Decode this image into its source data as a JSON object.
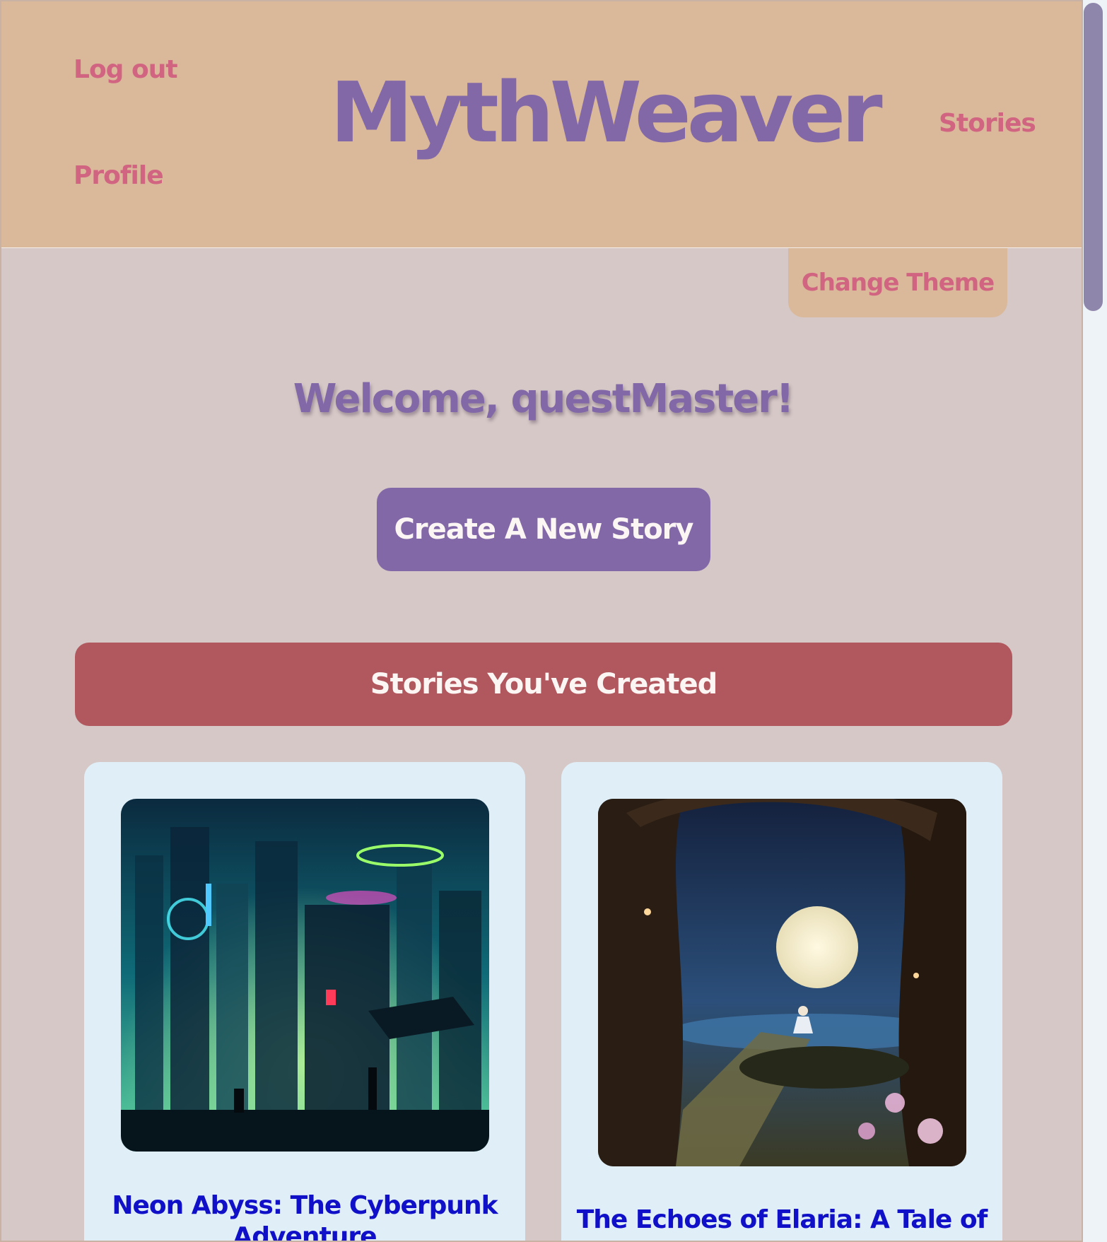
{
  "header": {
    "brand": "MythWeaver",
    "nav": {
      "logout": "Log out",
      "profile": "Profile",
      "stories": "Stories"
    }
  },
  "theme_button": "Change Theme",
  "welcome": "Welcome, questMaster!",
  "create_button": "Create A New Story",
  "section_title": "Stories You've Created",
  "stories": [
    {
      "title": "Neon Abyss: The Cyberpunk Adventure",
      "image": "cyberpunk-city-image"
    },
    {
      "title": "The Echoes of Elaria: A Tale of",
      "image": "moonlit-forest-image"
    }
  ],
  "colors": {
    "header_bg": "#dab89a",
    "page_bg": "#d5c8c6",
    "brand": "#8368a8",
    "link": "#d16481",
    "section_bar": "#b1575e",
    "card_bg": "#e0eff7",
    "card_title": "#1010c8"
  }
}
